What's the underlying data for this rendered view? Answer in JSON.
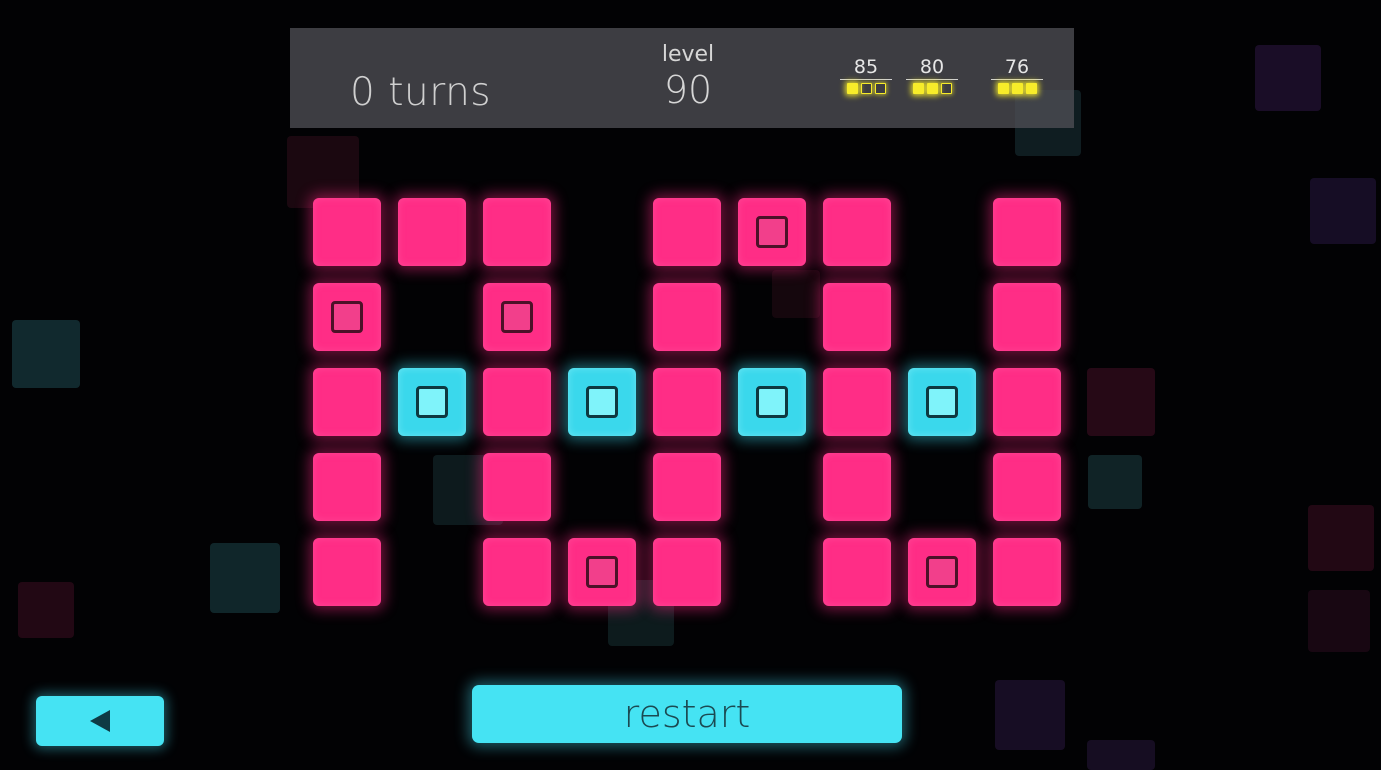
{
  "hud": {
    "turns_text": "0 turns",
    "level_label": "level",
    "level_number": "90",
    "star_goals": [
      {
        "turns": "85",
        "stars_filled": 1,
        "stars_total": 3
      },
      {
        "turns": "80",
        "stars_filled": 2,
        "stars_total": 3
      },
      {
        "turns": "76",
        "stars_filled": 3,
        "stars_total": 3
      }
    ]
  },
  "board": {
    "rows": 5,
    "cols": 9,
    "cells": [
      [
        "pink",
        "pink",
        "pink",
        null,
        "pink",
        "pink",
        "pink",
        null,
        "pink"
      ],
      [
        "pink",
        null,
        "pink",
        null,
        "pink",
        null,
        "pink",
        null,
        "pink"
      ],
      [
        "pink",
        "cyan",
        "pink",
        "cyan",
        "pink",
        "cyan",
        "pink",
        "cyan",
        "pink"
      ],
      [
        "pink",
        null,
        "pink",
        null,
        "pink",
        null,
        "pink",
        null,
        "pink"
      ],
      [
        "pink",
        null,
        "pink",
        "pink",
        "pink",
        null,
        "pink",
        "pink",
        "pink"
      ]
    ],
    "markers": [
      [
        0,
        5
      ],
      [
        1,
        0
      ],
      [
        1,
        2
      ],
      [
        2,
        1
      ],
      [
        2,
        3
      ],
      [
        2,
        5
      ],
      [
        2,
        7
      ],
      [
        4,
        3
      ],
      [
        4,
        7
      ]
    ]
  },
  "controls": {
    "back_icon": "back-arrow-icon",
    "restart_label": "restart"
  },
  "colors": {
    "background": "#020204",
    "pink_tile": "#ff2d86",
    "cyan_tile": "#3ad8ec",
    "button": "#45e3f3",
    "star_pip": "#f7ec2a"
  }
}
